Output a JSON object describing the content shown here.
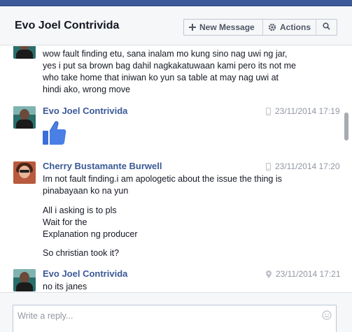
{
  "header": {
    "title": "Evo Joel Contrivida",
    "new_message_label": "New Message",
    "actions_label": "Actions",
    "icons": [
      "plus-icon",
      "gear-icon",
      "search-icon"
    ]
  },
  "messages": [
    {
      "sender": "",
      "lines": [
        "wow fault finding etu, sana inalam mo kung sino nag uwi ng jar,",
        "yes i put sa brown bag dahil nagkakatuwaan kami pero its not me",
        "who take home that iniwan ko yun sa table at may nag uwi at",
        "hindi ako, wrong move"
      ]
    },
    {
      "sender": "Evo Joel Contrivida",
      "timestamp": "23/11/2014 17:19",
      "source_icon": "mobile-icon",
      "content": "thumbs-up-sticker"
    },
    {
      "sender": "Cherry Bustamante Burwell",
      "timestamp": "23/11/2014 17:20",
      "source_icon": "mobile-icon",
      "paragraphs": [
        [
          "Im not fault finding.i am apologetic about the issue the thing is",
          "pinabayaan ko na yun"
        ],
        [
          "All i  asking is to pls",
          "Wait for the",
          "Explanation ng producer"
        ],
        [
          "So christian took it?"
        ]
      ]
    },
    {
      "sender": "Evo Joel Contrivida",
      "timestamp": "23/11/2014 17:21",
      "source_icon": "location-pin-icon",
      "lines": [
        "no its janes"
      ]
    }
  ],
  "composer": {
    "placeholder": "Write a reply..."
  },
  "colors": {
    "brand": "#3b5998",
    "sender_link": "#3b5998",
    "muted": "#9197a3",
    "like_blue": "#3b5998"
  }
}
